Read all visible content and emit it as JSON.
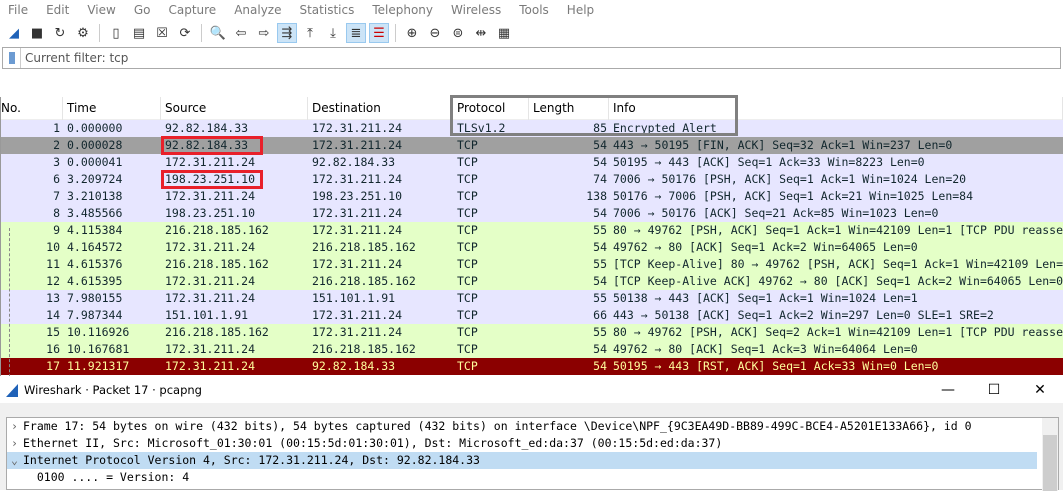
{
  "menu": [
    "File",
    "Edit",
    "View",
    "Go",
    "Capture",
    "Analyze",
    "Statistics",
    "Telephony",
    "Wireless",
    "Tools",
    "Help"
  ],
  "toolbar": [
    "shark-fin-icon",
    "stop-icon",
    "restart-icon",
    "options-gear-icon",
    "open-folder-icon",
    "save-file-icon",
    "close-file-icon",
    "reload-icon",
    "find-icon",
    "back-icon",
    "forward-icon",
    "go-to-packet-icon",
    "first-packet-icon",
    "last-packet-icon",
    "autoscroll-icon",
    "colorize-icon",
    "zoom-in-icon",
    "zoom-out-icon",
    "zoom-normal-icon",
    "resize-columns-icon",
    "layout-icon"
  ],
  "filter": {
    "text": "Current filter: tcp"
  },
  "columns": [
    "No.",
    "Time",
    "Source",
    "Destination",
    "Protocol",
    "Length",
    "Info"
  ],
  "colors": {
    "tcp_row": "#e7e6ff",
    "http_row": "#e4ffc7",
    "selected_row": "#a0a0a0",
    "rst_row": "#8b0000",
    "highlight_red": "#e8202a"
  },
  "packets": [
    {
      "no": "1",
      "time": "0.000000",
      "src": "92.82.184.33",
      "dst": "172.31.211.24",
      "proto": "TLSv1.2",
      "len": "85",
      "info": "Encrypted Alert",
      "cls": "p"
    },
    {
      "no": "2",
      "time": "0.000028",
      "src": "92.82.184.33",
      "dst": "172.31.211.24",
      "proto": "TCP",
      "len": "54",
      "info": "443 → 50195 [FIN, ACK] Seq=32 Ack=1 Win=237 Len=0",
      "cls": "sel"
    },
    {
      "no": "3",
      "time": "0.000041",
      "src": "172.31.211.24",
      "dst": "92.82.184.33",
      "proto": "TCP",
      "len": "54",
      "info": "50195 → 443 [ACK] Seq=1 Ack=33 Win=8223 Len=0",
      "cls": "p"
    },
    {
      "no": "6",
      "time": "3.209724",
      "src": "198.23.251.10",
      "dst": "172.31.211.24",
      "proto": "TCP",
      "len": "74",
      "info": "7006 → 50176 [PSH, ACK] Seq=1 Ack=1 Win=1024 Len=20",
      "cls": "p"
    },
    {
      "no": "7",
      "time": "3.210138",
      "src": "172.31.211.24",
      "dst": "198.23.251.10",
      "proto": "TCP",
      "len": "138",
      "info": "50176 → 7006 [PSH, ACK] Seq=1 Ack=21 Win=1025 Len=84",
      "cls": "p"
    },
    {
      "no": "8",
      "time": "3.485566",
      "src": "198.23.251.10",
      "dst": "172.31.211.24",
      "proto": "TCP",
      "len": "54",
      "info": "7006 → 50176 [ACK] Seq=21 Ack=85 Win=1023 Len=0",
      "cls": "p"
    },
    {
      "no": "9",
      "time": "4.115384",
      "src": "216.218.185.162",
      "dst": "172.31.211.24",
      "proto": "TCP",
      "len": "55",
      "info": "80 → 49762 [PSH, ACK] Seq=1 Ack=1 Win=42109 Len=1 [TCP PDU reasse",
      "cls": "g"
    },
    {
      "no": "10",
      "time": "4.164572",
      "src": "172.31.211.24",
      "dst": "216.218.185.162",
      "proto": "TCP",
      "len": "54",
      "info": "49762 → 80 [ACK] Seq=1 Ack=2 Win=64065 Len=0",
      "cls": "g"
    },
    {
      "no": "11",
      "time": "4.615376",
      "src": "216.218.185.162",
      "dst": "172.31.211.24",
      "proto": "TCP",
      "len": "55",
      "info": "[TCP Keep-Alive] 80 → 49762 [PSH, ACK] Seq=1 Ack=1 Win=42109 Len=",
      "cls": "g"
    },
    {
      "no": "12",
      "time": "4.615395",
      "src": "172.31.211.24",
      "dst": "216.218.185.162",
      "proto": "TCP",
      "len": "54",
      "info": "[TCP Keep-Alive ACK] 49762 → 80 [ACK] Seq=1 Ack=2 Win=64065 Len=0",
      "cls": "g"
    },
    {
      "no": "13",
      "time": "7.980155",
      "src": "172.31.211.24",
      "dst": "151.101.1.91",
      "proto": "TCP",
      "len": "55",
      "info": "50138 → 443 [ACK] Seq=1 Ack=1 Win=1024 Len=1",
      "cls": "p"
    },
    {
      "no": "14",
      "time": "7.987344",
      "src": "151.101.1.91",
      "dst": "172.31.211.24",
      "proto": "TCP",
      "len": "66",
      "info": "443 → 50138 [ACK] Seq=1 Ack=2 Win=297 Len=0 SLE=1 SRE=2",
      "cls": "p"
    },
    {
      "no": "15",
      "time": "10.116926",
      "src": "216.218.185.162",
      "dst": "172.31.211.24",
      "proto": "TCP",
      "len": "55",
      "info": "80 → 49762 [PSH, ACK] Seq=2 Ack=1 Win=42109 Len=1 [TCP PDU reasse",
      "cls": "g"
    },
    {
      "no": "16",
      "time": "10.167681",
      "src": "172.31.211.24",
      "dst": "216.218.185.162",
      "proto": "TCP",
      "len": "54",
      "info": "49762 → 80 [ACK] Seq=1 Ack=3 Win=64064 Len=0",
      "cls": "g"
    },
    {
      "no": "17",
      "time": "11.921317",
      "src": "172.31.211.24",
      "dst": "92.82.184.33",
      "proto": "TCP",
      "len": "54",
      "info": "50195 → 443 [RST, ACK] Seq=1 Ack=33 Win=0 Len=0",
      "cls": "rst"
    }
  ],
  "detail_window": {
    "title": "Wireshark · Packet 17 ·  pcapng",
    "controls": [
      "—",
      "☐",
      "✕"
    ],
    "rows": [
      {
        "arrow": "›",
        "text": "Frame 17: 54 bytes on wire (432 bits), 54 bytes captured (432 bits) on interface \\Device\\NPF_{9C3EA49D-BB89-499C-BCE4-A5201E133A66}, id 0"
      },
      {
        "arrow": "›",
        "text": "Ethernet II, Src: Microsoft_01:30:01 (00:15:5d:01:30:01), Dst: Microsoft_ed:da:37 (00:15:5d:ed:da:37)"
      },
      {
        "arrow": "⌄",
        "text": "Internet Protocol Version 4, Src: 172.31.211.24, Dst: 92.82.184.33"
      },
      {
        "arrow": "",
        "text": "  0100 .... = Version: 4"
      }
    ]
  }
}
